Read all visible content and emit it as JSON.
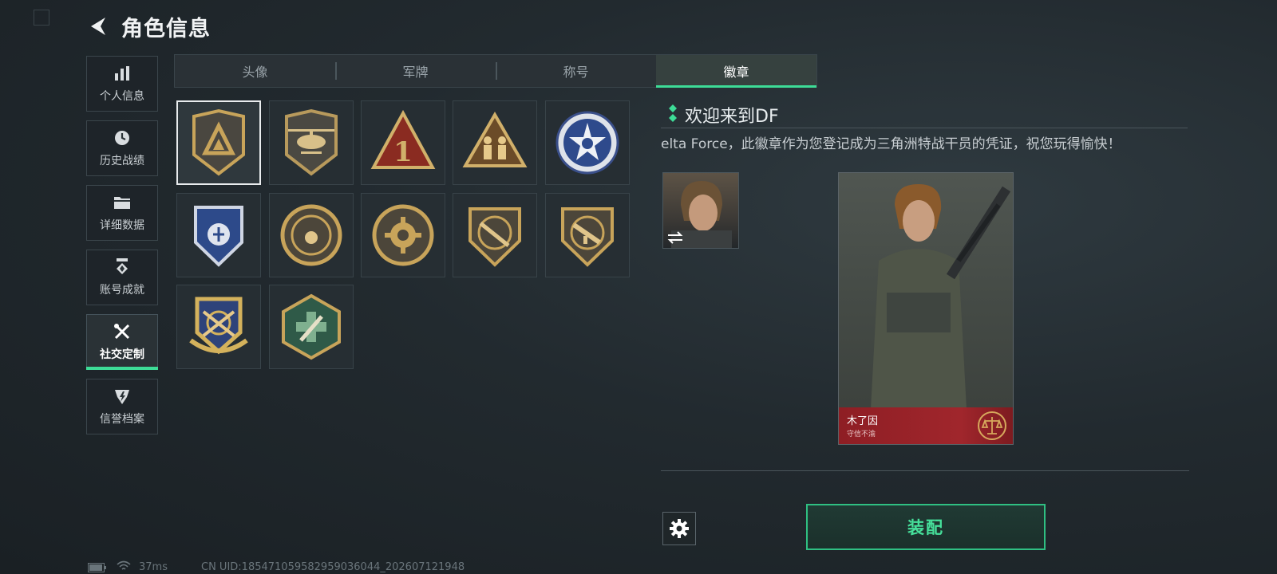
{
  "header": {
    "title": "角色信息"
  },
  "sidebar": {
    "items": [
      {
        "label": "个人信息",
        "icon": "bar-chart-icon"
      },
      {
        "label": "历史战绩",
        "icon": "clock-icon"
      },
      {
        "label": "详细数据",
        "icon": "folder-icon"
      },
      {
        "label": "账号成就",
        "icon": "medal-icon"
      },
      {
        "label": "社交定制",
        "icon": "tools-icon",
        "active": true
      },
      {
        "label": "信誉档案",
        "icon": "shield-icon"
      }
    ]
  },
  "tabs": [
    {
      "label": "头像"
    },
    {
      "label": "军牌"
    },
    {
      "label": "称号"
    },
    {
      "label": "徽章",
      "active": true
    }
  ],
  "badges": [
    {
      "icon": "delta-shield-badge-icon",
      "selected": true
    },
    {
      "icon": "helicopter-badge-icon"
    },
    {
      "icon": "number-one-triangle-badge-icon"
    },
    {
      "icon": "soldiers-triangle-badge-icon"
    },
    {
      "icon": "star-skull-badge-icon"
    },
    {
      "icon": "blue-shield-badge-icon"
    },
    {
      "icon": "round-emblem-badge-icon"
    },
    {
      "icon": "gear-emblem-badge-icon"
    },
    {
      "icon": "rifle-shield-badge-icon"
    },
    {
      "icon": "smg-shield-badge-icon"
    },
    {
      "icon": "crossed-rifles-badge-icon"
    },
    {
      "icon": "medic-hexagon-badge-icon"
    }
  ],
  "detail": {
    "title": "欢迎来到DF",
    "description": "elta Force，此徽章作为您登记成为三角洲特战干员的凭证，祝您玩得愉快！",
    "card": {
      "name": "木了因",
      "motto": "守信不渝"
    },
    "equip_label": "装配"
  },
  "status": {
    "ping": "37ms",
    "uid": "CN UID:1854710595829590360­44_202607121948"
  },
  "colors": {
    "accent": "#3ddc97",
    "card_red": "#a0262c",
    "badge_gold": "#c8a45a"
  }
}
